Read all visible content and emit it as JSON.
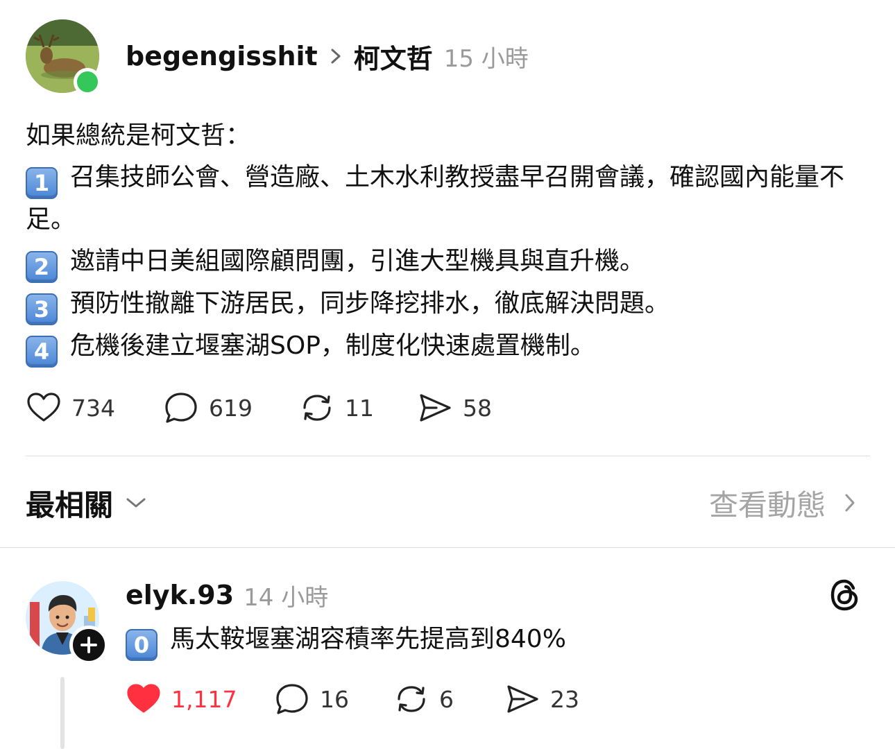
{
  "post": {
    "username": "begengisshit",
    "topic": "柯文哲",
    "time": "15 小時",
    "lines": [
      {
        "text": "如果總統是柯文哲："
      },
      {
        "key": "1",
        "text": "召集技師公會、營造廠、土木水利教授盡早召開會議，確認國內能量不足。"
      },
      {
        "key": "2",
        "text": "邀請中日美組國際顧問團，引進大型機具與直升機。"
      },
      {
        "key": "3",
        "text": "預防性撤離下游居民，同步降挖排水，徹底解決問題。"
      },
      {
        "key": "4",
        "text": "危機後建立堰塞湖SOP，制度化快速處置機制。"
      }
    ],
    "stats": {
      "likes": "734",
      "comments": "619",
      "reposts": "11",
      "shares": "58"
    }
  },
  "section": {
    "title": "最相關",
    "view_activity": "查看動態"
  },
  "reply": {
    "username": "elyk.93",
    "time": "14 小時",
    "key": "0",
    "text": "馬太鞍堰塞湖容積率先提高到840%",
    "stats": {
      "likes": "1,117",
      "comments": "16",
      "reposts": "6",
      "shares": "23"
    },
    "liked": true
  },
  "icons": {
    "like": "heart-icon",
    "comment": "comment-bubble-icon",
    "repost": "repost-icon",
    "share": "send-icon",
    "brand": "threads-logo-icon",
    "follow": "plus-icon"
  },
  "colors": {
    "liked": "#ff3040",
    "online": "#35c759",
    "muted": "#9a9a9a",
    "keycap": "#4a86d6"
  }
}
